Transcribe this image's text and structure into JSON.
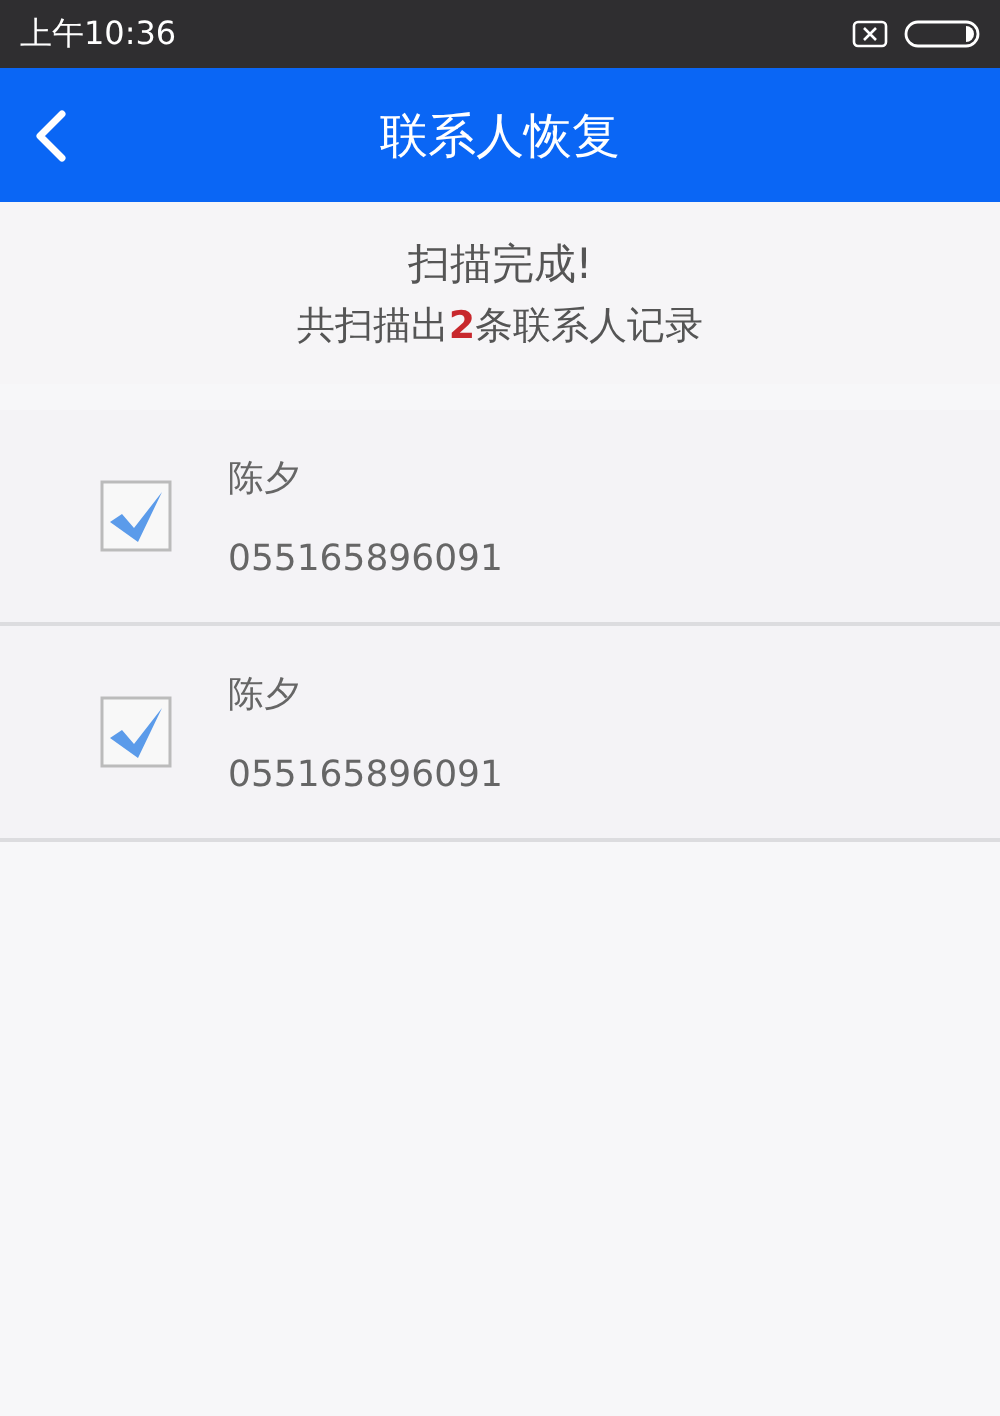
{
  "status_bar": {
    "time": "上午10:36"
  },
  "header": {
    "title": "联系人恢复"
  },
  "summary": {
    "title": "扫描完成!",
    "detail": "共扫描出**2**条联系人记录"
  },
  "contacts": [
    {
      "name": "陈夕",
      "phone": "055165896091",
      "checked": true
    },
    {
      "name": "陈夕",
      "phone": "055165896091",
      "checked": true
    }
  ]
}
